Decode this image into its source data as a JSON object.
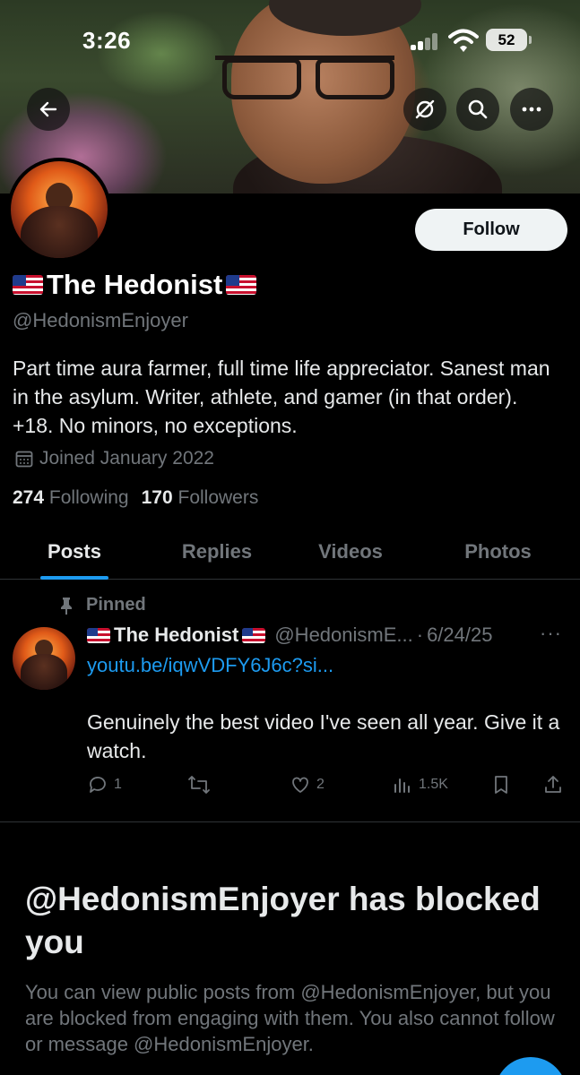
{
  "status_bar": {
    "time": "3:26",
    "battery": "52"
  },
  "header": {
    "back_icon": "arrow-left-icon",
    "grok_icon": "grok-icon",
    "search_icon": "search-icon",
    "more_icon": "more-horizontal-icon"
  },
  "profile": {
    "display_name": "The Hedonist",
    "handle": "@HedonismEnjoyer",
    "bio": "Part time aura farmer, full time life appreciator. Sanest man in the asylum. Writer, athlete, and gamer (in that order). +18. No minors, no exceptions.",
    "joined": "Joined January 2022",
    "following_count": "274",
    "following_label": "Following",
    "followers_count": "170",
    "followers_label": "Followers",
    "follow_button": "Follow"
  },
  "tabs": [
    {
      "label": "Posts",
      "active": true
    },
    {
      "label": "Replies",
      "active": false
    },
    {
      "label": "Videos",
      "active": false
    },
    {
      "label": "Photos",
      "active": false
    }
  ],
  "pinned_post": {
    "pinned_label": "Pinned",
    "author_name": "The Hedonist",
    "author_handle": "@HedonismE...",
    "date": "6/24/25",
    "link": "youtu.be/iqwVDFY6J6c?si...",
    "text": "Genuinely the best video I've seen all year. Give it a watch.",
    "replies": "1",
    "reposts": "",
    "likes": "2",
    "views": "1.5K"
  },
  "blocked": {
    "title": "@HedonismEnjoyer has blocked you",
    "description": "You can view public posts from @HedonismEnjoyer, but you are blocked from engaging with them. You also cannot follow or message @HedonismEnjoyer."
  },
  "colors": {
    "accent": "#1d9bf0",
    "muted": "#71767b",
    "text": "#e7e9ea",
    "background": "#000000"
  }
}
